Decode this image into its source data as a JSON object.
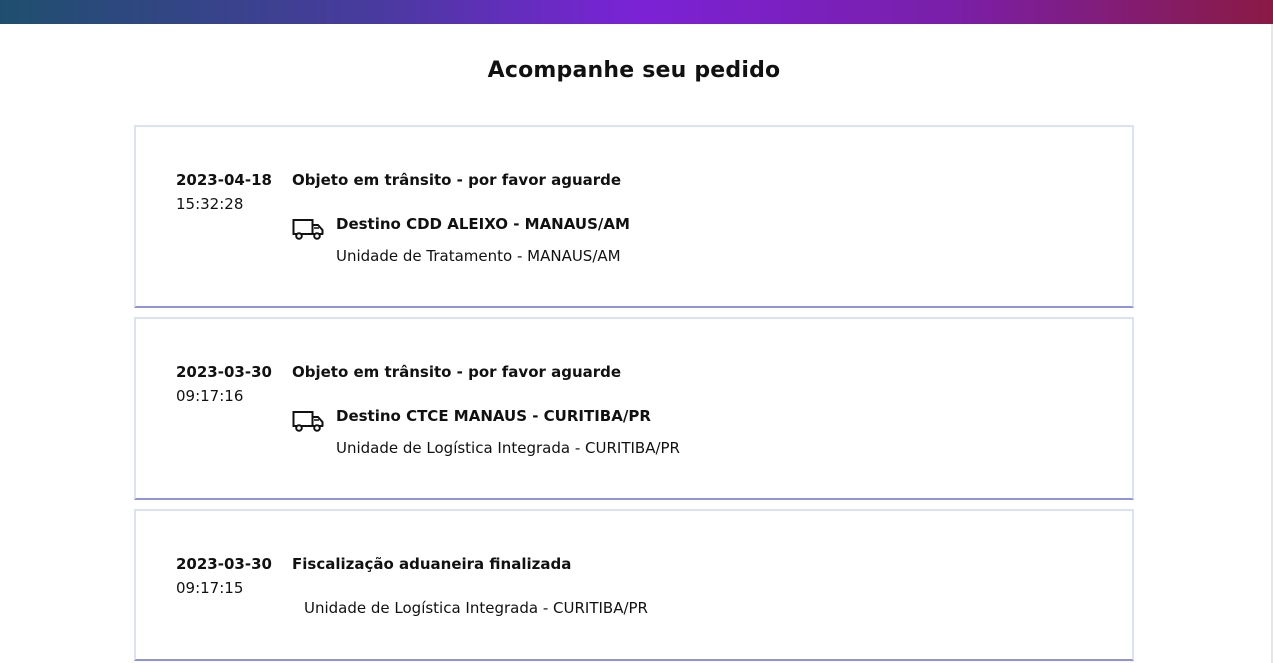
{
  "header": {
    "title": "Acompanhe seu pedido"
  },
  "events": [
    {
      "date": "2023-04-18",
      "time": "15:32:28",
      "status": "Objeto em trânsito - por favor aguarde",
      "icon": "truck-icon",
      "destination": "Destino CDD ALEIXO - MANAUS/AM",
      "unit": "Unidade de Tratamento - MANAUS/AM"
    },
    {
      "date": "2023-03-30",
      "time": "09:17:16",
      "status": "Objeto em trânsito - por favor aguarde",
      "icon": "truck-icon",
      "destination": "Destino CTCE MANAUS - CURITIBA/PR",
      "unit": "Unidade de Logística Integrada - CURITIBA/PR"
    },
    {
      "date": "2023-03-30",
      "time": "09:17:15",
      "status": "Fiscalização aduaneira finalizada",
      "unit": "Unidade de Logística Integrada - CURITIBA/PR"
    }
  ],
  "colors": {
    "gradient": [
      "#1f4f6e",
      "#4a3aa0",
      "#7b22d6",
      "#7a1fa8",
      "#8a1a44"
    ],
    "card_border": "#dde1f7",
    "card_bottom_border": "#8f93dd"
  }
}
